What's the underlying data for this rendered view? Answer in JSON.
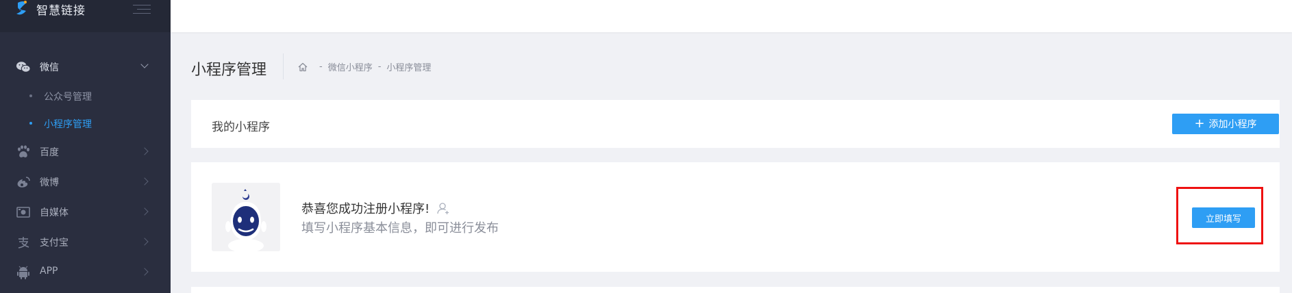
{
  "brand": {
    "name": "智慧链接",
    "logo_icon": "brand-logo-icon",
    "menu_toggle_icon": "menu-toggle-icon"
  },
  "sidebar": {
    "items": [
      {
        "label": "微信",
        "icon": "wechat-icon",
        "expanded": true,
        "children": [
          {
            "label": "公众号管理",
            "active": false
          },
          {
            "label": "小程序管理",
            "active": true
          }
        ]
      },
      {
        "label": "百度",
        "icon": "paw-icon"
      },
      {
        "label": "微博",
        "icon": "weibo-icon"
      },
      {
        "label": "自媒体",
        "icon": "media-icon"
      },
      {
        "label": "支付宝",
        "icon": "alipay-icon"
      },
      {
        "label": "APP",
        "icon": "android-icon"
      }
    ]
  },
  "page": {
    "title": "小程序管理",
    "breadcrumb": {
      "home_icon": "home-icon",
      "separator": "-",
      "items": [
        "微信小程序",
        "小程序管理"
      ]
    }
  },
  "my_miniprogram": {
    "title": "我的小程序",
    "add_button_plus": "+",
    "add_button": "添加小程序"
  },
  "notice": {
    "title": "恭喜您成功注册小程序!",
    "subtitle": "填写小程序基本信息，即可进行发布",
    "user_icon": "add-user-icon",
    "action_button": "立即填写"
  },
  "colors": {
    "accent": "#2e9ef4",
    "sidebar_bg": "#2a2e3f",
    "highlight": "#ee1111"
  }
}
